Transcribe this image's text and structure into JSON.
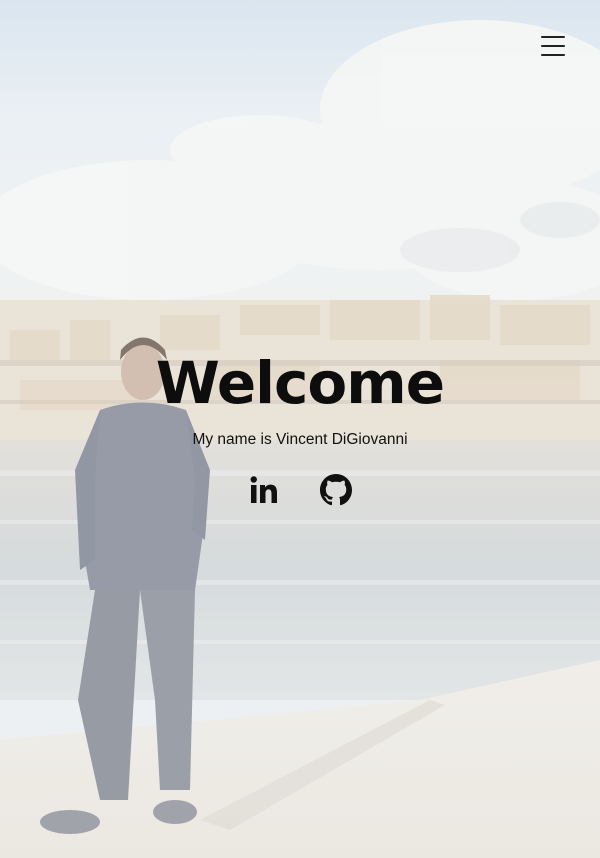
{
  "hero": {
    "title": "Welcome",
    "subtitle": "My name is Vincent DiGiovanni"
  },
  "nav": {
    "menu_icon": "hamburger-menu-icon"
  },
  "social": [
    {
      "icon": "linkedin-icon"
    },
    {
      "icon": "github-icon"
    }
  ],
  "colors": {
    "text": "#0d0d0d",
    "sky": "#dfe8f0",
    "water": "#cfd6da",
    "ground": "#efece6"
  }
}
